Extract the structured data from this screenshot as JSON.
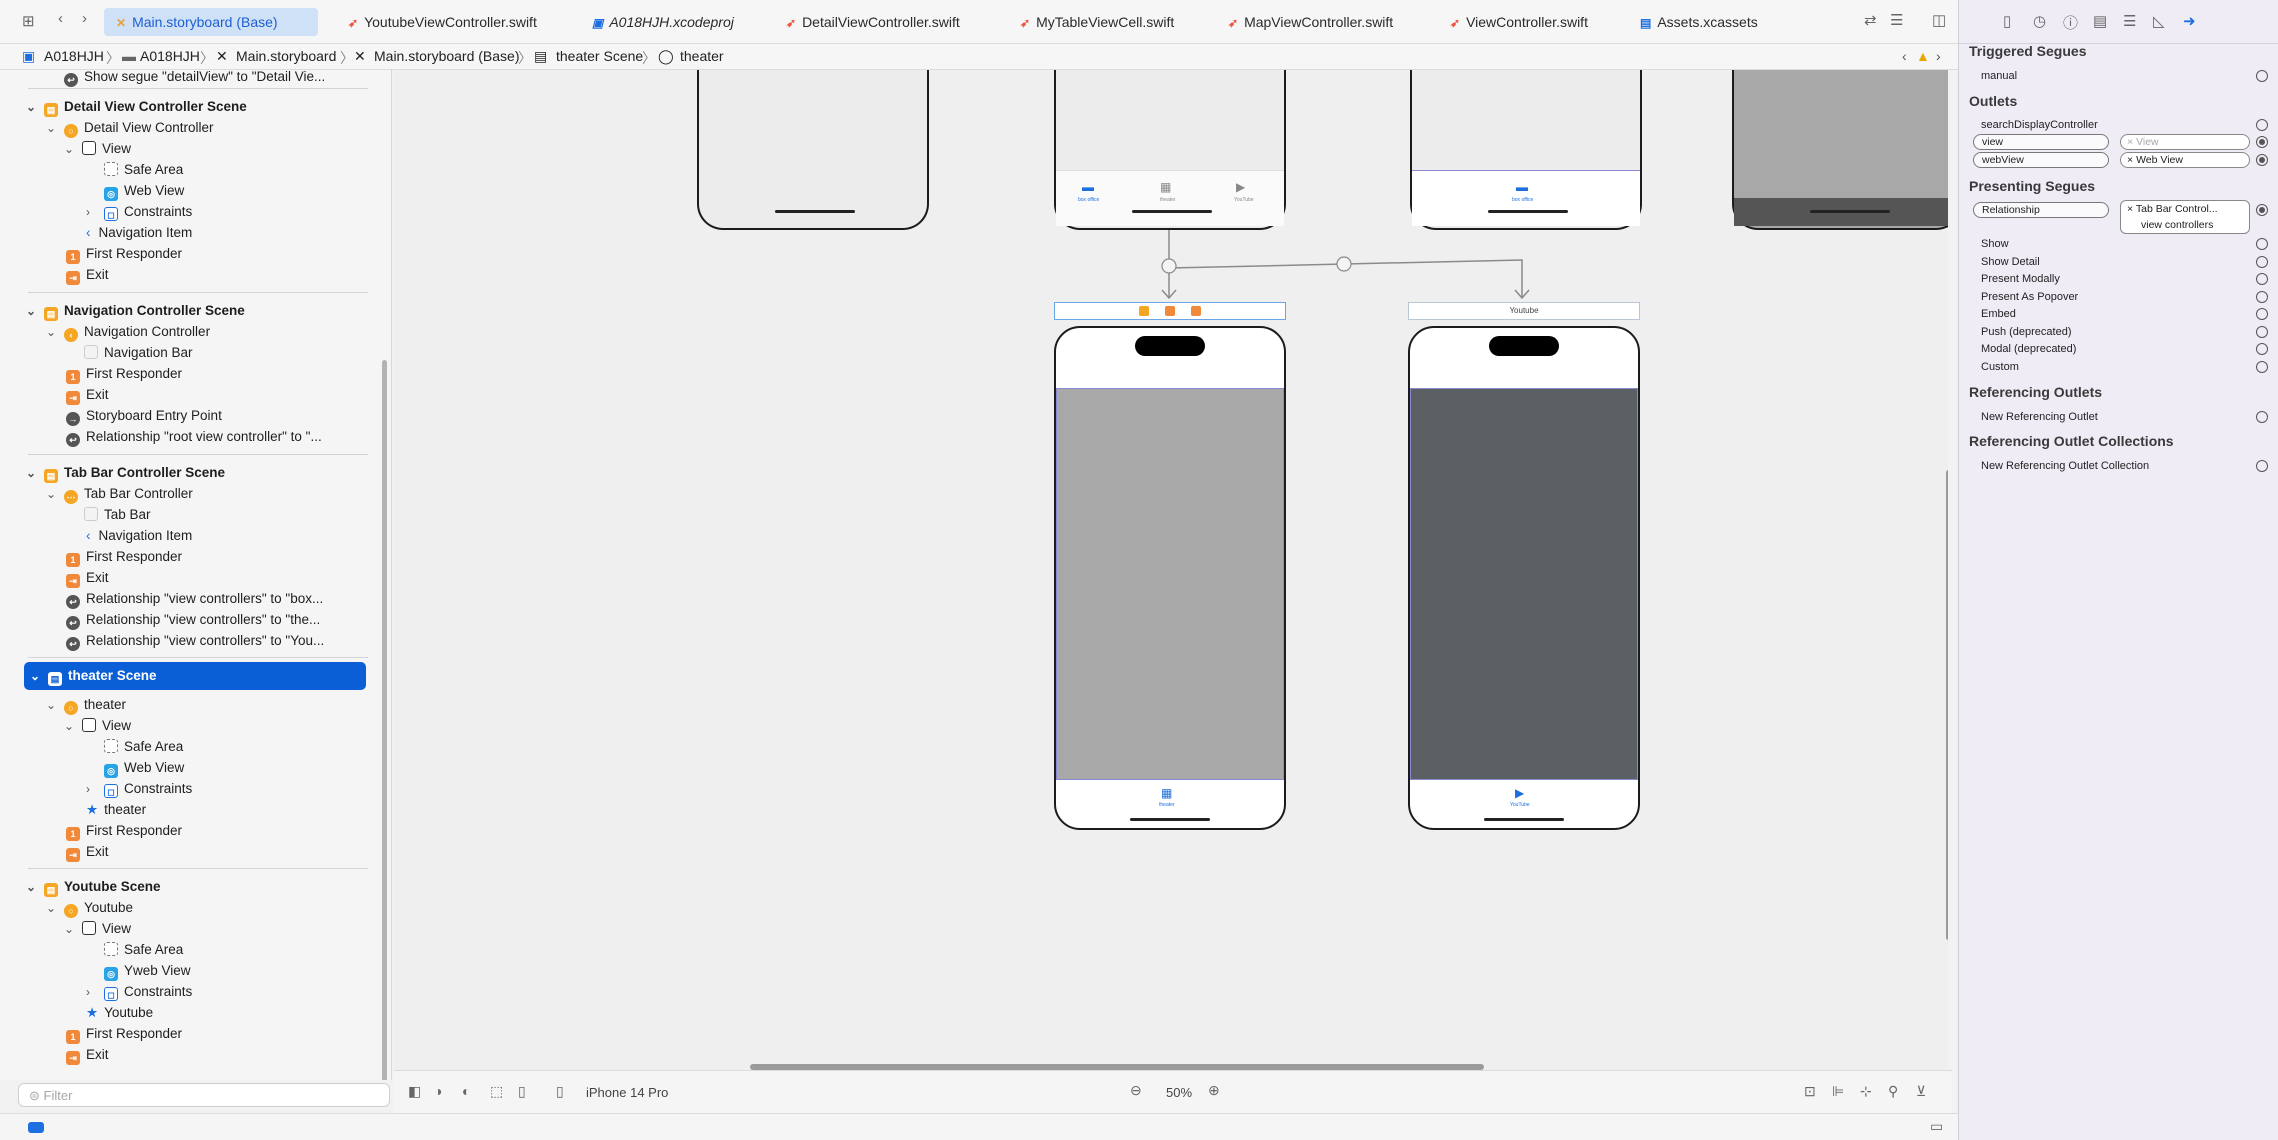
{
  "tabs": [
    {
      "label": "Main.storyboard (Base)",
      "icon": "storyboard-icon",
      "active": true
    },
    {
      "label": "YoutubeViewController.swift",
      "icon": "swift-icon"
    },
    {
      "label": "A018HJH.xcodeproj",
      "icon": "xcodeproj-icon"
    },
    {
      "label": "DetailViewController.swift",
      "icon": "swift-icon"
    },
    {
      "label": "MyTableViewCell.swift",
      "icon": "swift-icon"
    },
    {
      "label": "MapViewController.swift",
      "icon": "swift-icon"
    },
    {
      "label": "ViewController.swift",
      "icon": "swift-icon"
    },
    {
      "label": "Assets.xcassets",
      "icon": "assets-icon"
    }
  ],
  "breadcrumb": [
    "A018HJH",
    "A018HJH",
    "Main.storyboard",
    "Main.storyboard (Base)",
    "theater Scene",
    "theater"
  ],
  "navigator": {
    "items": [
      {
        "label": "Show segue \"detailView\" to \"Detail Vie...",
        "icon": "segue-icon"
      },
      {
        "label": "Detail View Controller Scene",
        "icon": "scene-icon"
      },
      {
        "label": "Detail View Controller",
        "icon": "view-controller-icon"
      },
      {
        "label": "View",
        "icon": "view-icon"
      },
      {
        "label": "Safe Area",
        "icon": "safe-area-icon"
      },
      {
        "label": "Web View",
        "icon": "web-view-icon"
      },
      {
        "label": "Constraints",
        "icon": "constraints-icon"
      },
      {
        "label": "Navigation Item",
        "icon": "navigation-item-icon"
      },
      {
        "label": "First Responder",
        "icon": "first-responder-icon"
      },
      {
        "label": "Exit",
        "icon": "exit-icon"
      },
      {
        "label": "Navigation Controller Scene",
        "icon": "scene-icon"
      },
      {
        "label": "Navigation Controller",
        "icon": "navigation-controller-icon"
      },
      {
        "label": "Navigation Bar",
        "icon": "navigation-bar-icon"
      },
      {
        "label": "First Responder",
        "icon": "first-responder-icon"
      },
      {
        "label": "Exit",
        "icon": "exit-icon"
      },
      {
        "label": "Storyboard Entry Point",
        "icon": "entry-point-icon"
      },
      {
        "label": "Relationship \"root view controller\" to \"...",
        "icon": "segue-icon"
      },
      {
        "label": "Tab Bar Controller Scene",
        "icon": "scene-icon"
      },
      {
        "label": "Tab Bar Controller",
        "icon": "tab-bar-controller-icon"
      },
      {
        "label": "Tab Bar",
        "icon": "tab-bar-icon"
      },
      {
        "label": "Navigation Item",
        "icon": "navigation-item-icon"
      },
      {
        "label": "First Responder",
        "icon": "first-responder-icon"
      },
      {
        "label": "Exit",
        "icon": "exit-icon"
      },
      {
        "label": "Relationship \"view controllers\" to \"box...",
        "icon": "segue-icon"
      },
      {
        "label": "Relationship \"view controllers\" to \"the...",
        "icon": "segue-icon"
      },
      {
        "label": "Relationship \"view controllers\" to \"You...",
        "icon": "segue-icon"
      },
      {
        "label": "theater Scene",
        "icon": "scene-icon"
      },
      {
        "label": "theater",
        "icon": "view-controller-icon"
      },
      {
        "label": "View",
        "icon": "view-icon"
      },
      {
        "label": "Safe Area",
        "icon": "safe-area-icon"
      },
      {
        "label": "Web View",
        "icon": "web-view-icon"
      },
      {
        "label": "Constraints",
        "icon": "constraints-icon"
      },
      {
        "label": "theater",
        "icon": "tab-bar-item-icon"
      },
      {
        "label": "First Responder",
        "icon": "first-responder-icon"
      },
      {
        "label": "Exit",
        "icon": "exit-icon"
      },
      {
        "label": "Youtube Scene",
        "icon": "scene-icon"
      },
      {
        "label": "Youtube",
        "icon": "view-controller-icon"
      },
      {
        "label": "View",
        "icon": "view-icon"
      },
      {
        "label": "Safe Area",
        "icon": "safe-area-icon"
      },
      {
        "label": "Yweb View",
        "icon": "web-view-icon"
      },
      {
        "label": "Constraints",
        "icon": "constraints-icon"
      },
      {
        "label": "Youtube",
        "icon": "tab-bar-item-icon"
      },
      {
        "label": "First Responder",
        "icon": "first-responder-icon"
      },
      {
        "label": "Exit",
        "icon": "exit-icon"
      }
    ],
    "filter_placeholder": "Filter"
  },
  "canvas": {
    "tab_labels": {
      "box_office": "box office",
      "theater": "theater",
      "youtube": "YouTube"
    },
    "youtube_scene_header": "Youtube",
    "device": "iPhone 14 Pro",
    "zoom": "50%"
  },
  "inspector": {
    "triggered_segues": {
      "title": "Triggered Segues",
      "items": [
        "manual"
      ]
    },
    "outlets": {
      "title": "Outlets",
      "items": [
        "searchDisplayController",
        "view",
        "webView"
      ],
      "view_target": "View",
      "webview_target": "Web View"
    },
    "presenting_segues": {
      "title": "Presenting Segues",
      "relationship": "Relationship",
      "relationship_target_1": "Tab Bar Control...",
      "relationship_target_2": "view controllers",
      "items": [
        "Show",
        "Show Detail",
        "Present Modally",
        "Present As Popover",
        "Embed",
        "Push (deprecated)",
        "Modal (deprecated)",
        "Custom"
      ]
    },
    "referencing_outlets": {
      "title": "Referencing Outlets",
      "item": "New Referencing Outlet"
    },
    "referencing_outlet_collections": {
      "title": "Referencing Outlet Collections",
      "item": "New Referencing Outlet Collection"
    }
  },
  "colors": {
    "accent": "#0a5fd6",
    "scene_icon": "#f5a623",
    "first_responder": "#f08a3a",
    "dark_view": "#5b6062",
    "gray_view": "#a8a8a8"
  }
}
